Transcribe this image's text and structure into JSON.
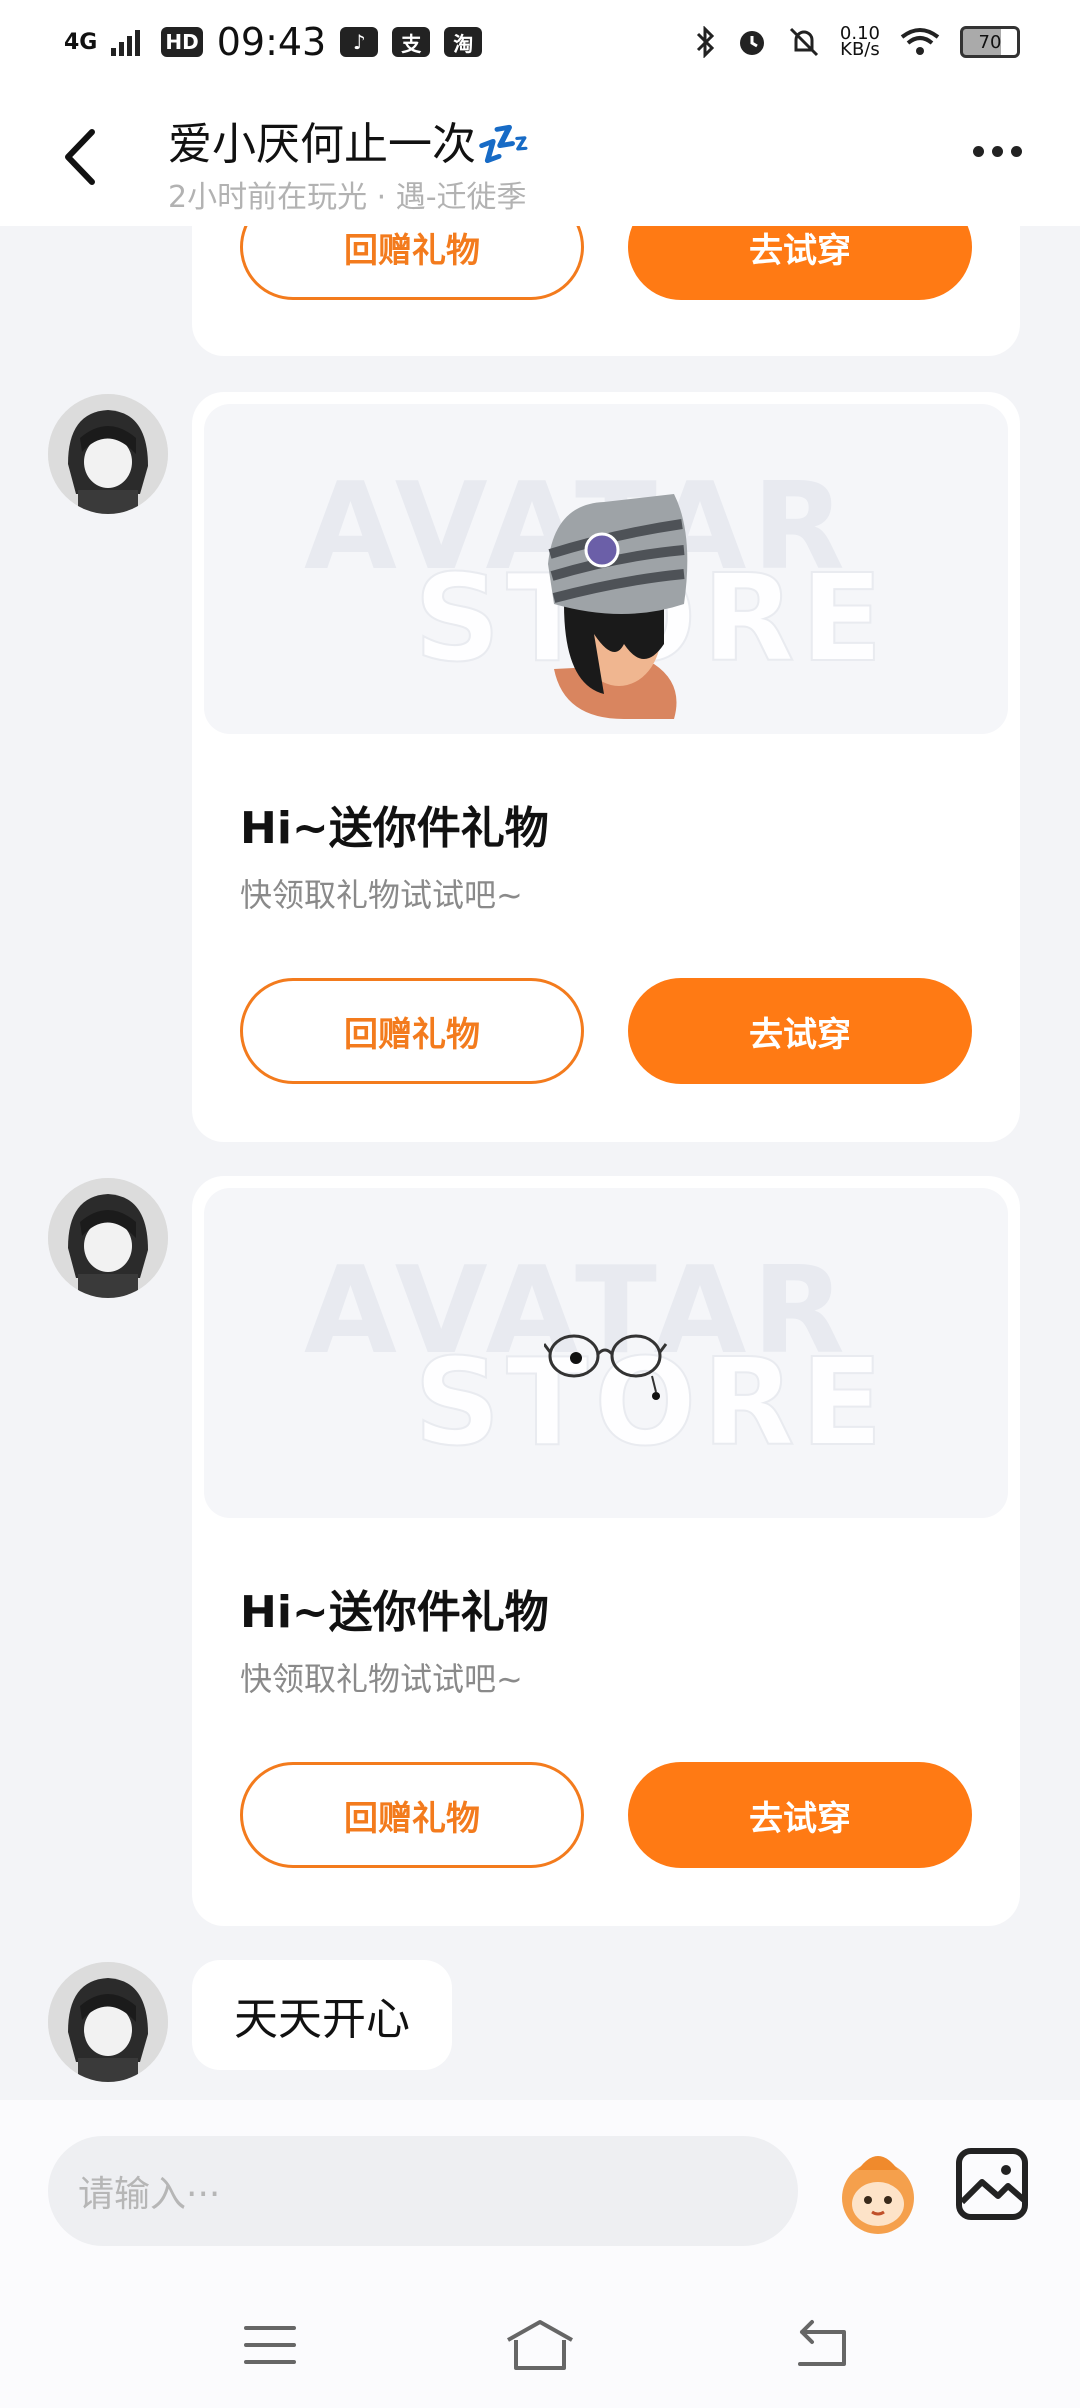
{
  "status_bar": {
    "signal_text": "4G",
    "hd_label": "HD",
    "time": "09:43",
    "app_icons": [
      "tiktok-icon",
      "alipay-icon",
      "taobao-icon"
    ],
    "alipay_label": "支",
    "taobao_label": "淘",
    "net_speed_value": "0.10",
    "net_speed_unit": "KB/s",
    "battery": "70"
  },
  "header": {
    "title": "爱小厌何止一次",
    "title_emoji": "💤",
    "subtitle": "2小时前在玩光 · 遇-迁徙季"
  },
  "messages": {
    "partial_card": {
      "return_gift_label": "回赠礼物",
      "try_on_label": "去试穿"
    },
    "gift_card_1": {
      "title": "Hi~送你件礼物",
      "desc": "快领取礼物试试吧~",
      "return_gift_label": "回赠礼物",
      "try_on_label": "去试穿",
      "watermark_top": "AVATAR",
      "watermark_bottom": "STORE"
    },
    "gift_card_2": {
      "title": "Hi~送你件礼物",
      "desc": "快领取礼物试试吧~",
      "return_gift_label": "回赠礼物",
      "try_on_label": "去试穿",
      "watermark_top": "AVATAR",
      "watermark_bottom": "STORE"
    },
    "text_message": "天天开心"
  },
  "input_bar": {
    "placeholder": "请输入···"
  },
  "colors": {
    "accent": "#ff7a14",
    "background": "#f3f4f7"
  }
}
